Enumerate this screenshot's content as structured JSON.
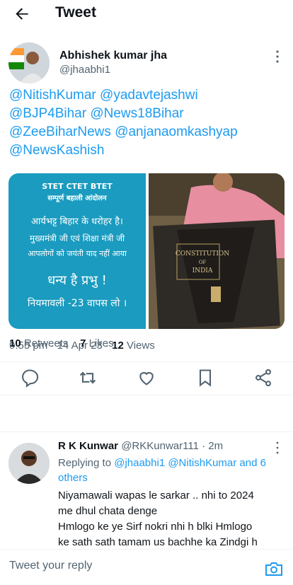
{
  "header": {
    "title": "Tweet"
  },
  "tweet": {
    "author": {
      "name": "Abhishek kumar jha",
      "handle": "@jhaabhi1"
    },
    "mentions": [
      "@NitishKumar",
      "@yadavtejashwi",
      "@BJP4Bihar",
      "@News18Bihar",
      "@ZeeBiharNews",
      "@anjanaomkashyap",
      "@NewsKashish"
    ],
    "media": {
      "poster": {
        "line1": "STET CTET BTET",
        "line2": "सम्पूर्ण बहाली आंदोलन",
        "line3": "आर्यभट्ट बिहार के धरोहर है।",
        "line4": "मुख्यमंत्री जी एवं शिक्षा मंत्री जी",
        "line5": "आपलोगों को जयंती याद नहीं आया",
        "line6": "धन्य है प्रभु !",
        "line7": "नियमावली -23 वापस लो ।"
      },
      "book": {
        "line1": "CONSTITUTION",
        "line2": "OF",
        "line3": "INDIA"
      }
    },
    "time": "9:55 pm",
    "date": "14 Apr 23",
    "views_count": "12",
    "views_label": "Views",
    "retweets_count": "10",
    "retweets_label": "Retweets",
    "likes_count": "7",
    "likes_label": "Likes"
  },
  "actions": [
    "reply-icon",
    "retweet-icon",
    "like-icon",
    "bookmark-icon",
    "share-icon"
  ],
  "reply": {
    "name": "R K Kunwar",
    "handle": "@RKKunwar111",
    "age": "2m",
    "replying_prefix": "Replying to",
    "replying_links": "@jhaabhi1 @NitishKumar and 6 others",
    "body_line1": "Niyamawali wapas le sarkar .. nhi to 2024",
    "body_line2": "me dhul chata denge",
    "body_line3": "Hmlogo ke ye Sirf nokri nhi h blki Hmlogo",
    "body_line4": "ke sath sath tamam us bachhe ka Zindgi h"
  },
  "composer": {
    "placeholder": "Tweet your reply"
  },
  "colors": {
    "accent": "#1d9bf0",
    "text": "#0f1419",
    "secondary": "#536471"
  }
}
